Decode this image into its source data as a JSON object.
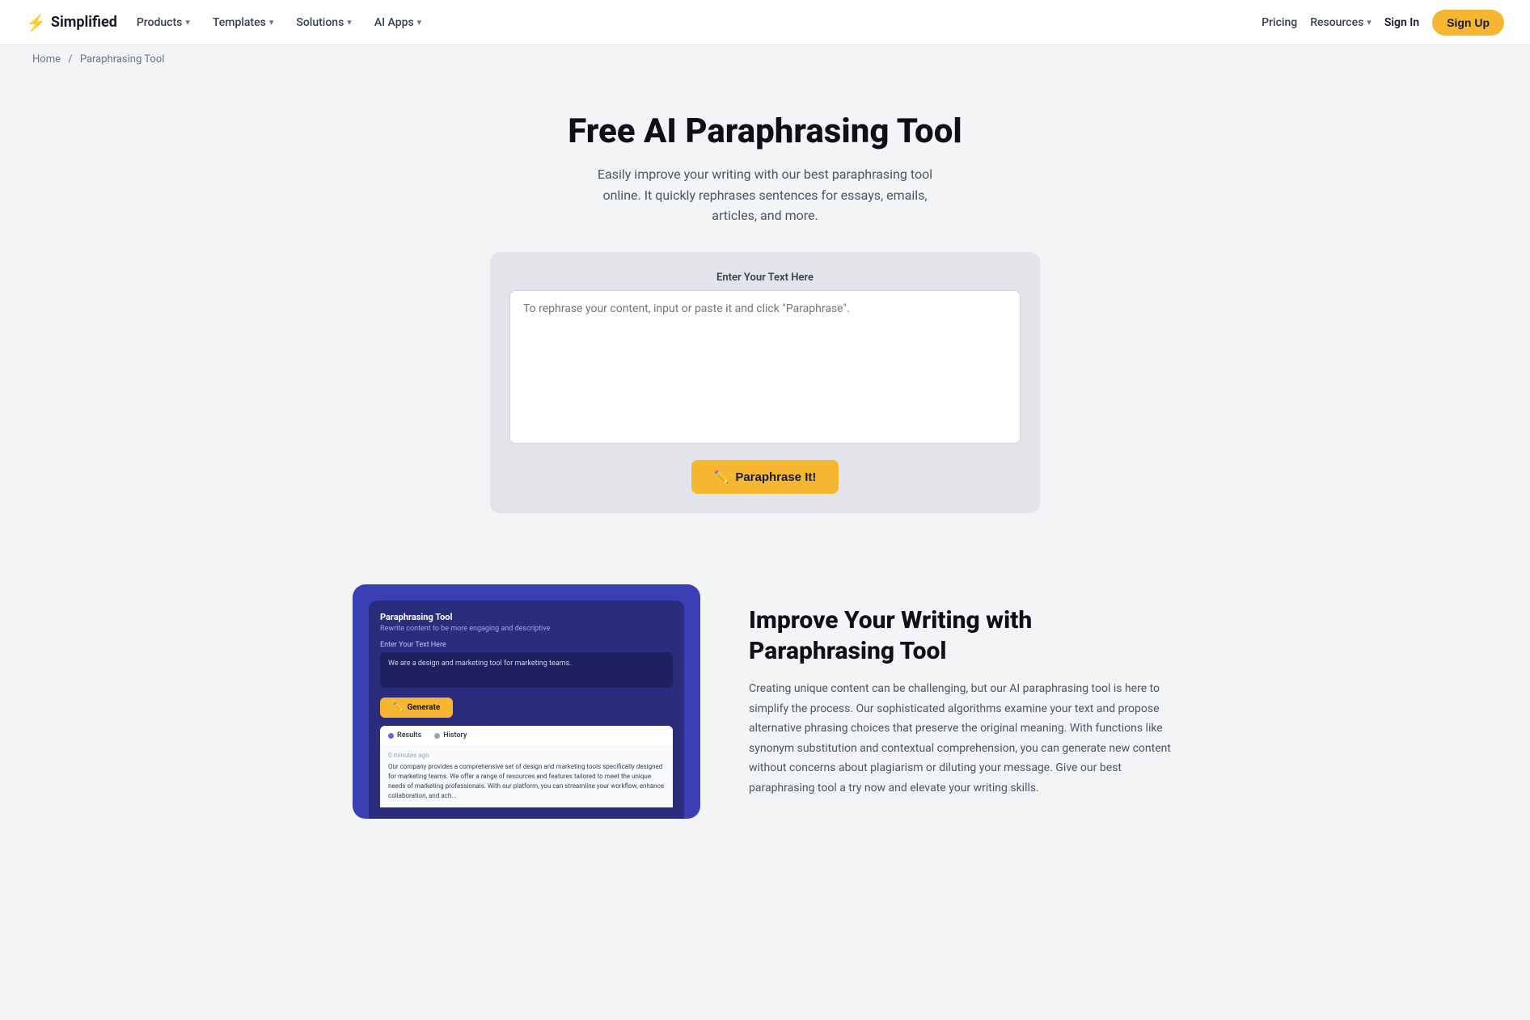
{
  "brand": {
    "logo_icon": "⚡",
    "logo_text": "Simplified"
  },
  "nav": {
    "items": [
      {
        "label": "Products",
        "has_dropdown": true
      },
      {
        "label": "Templates",
        "has_dropdown": true
      },
      {
        "label": "Solutions",
        "has_dropdown": true
      },
      {
        "label": "AI Apps",
        "has_dropdown": true
      }
    ],
    "right_items": [
      {
        "label": "Pricing",
        "has_dropdown": false
      },
      {
        "label": "Resources",
        "has_dropdown": true
      }
    ],
    "signin_label": "Sign In",
    "signup_label": "Sign Up"
  },
  "breadcrumb": {
    "home": "Home",
    "separator": "/",
    "current": "Paraphrasing Tool"
  },
  "hero": {
    "title": "Free AI Paraphrasing Tool",
    "description": "Easily improve your writing with our best paraphrasing tool online. It quickly rephrases sentences for essays, emails, articles, and more."
  },
  "tool": {
    "label": "Enter Your Text Here",
    "placeholder": "To rephrase your content, input or paste it and click \"Paraphrase\".",
    "button_icon": "✏️",
    "button_label": "Paraphrase It!"
  },
  "screenshot": {
    "title": "Paraphrasing Tool",
    "subtitle": "Rewrite content to be more engaging and descriptive",
    "input_label": "Enter Your Text Here",
    "input_text": "We are a design and marketing tool for marketing teams.",
    "generate_icon": "✏️",
    "generate_label": "Generate",
    "results_tab": "Results",
    "history_tab": "History",
    "output_meta": "0 minutes ago",
    "output_text": "Our company provides a comprehensive set of design and marketing tools specifically designed for marketing teams. We offer a range of resources and features tailored to meet the unique needs of marketing professionals. With our platform, you can streamline your workflow, enhance collaboration, and ach..."
  },
  "feature": {
    "title": "Improve Your Writing with Paraphrasing Tool",
    "description": "Creating unique content can be challenging, but our AI paraphrasing tool is here to simplify the process. Our sophisticated algorithms examine your text and propose alternative phrasing choices that preserve the original meaning. With functions like synonym substitution and contextual comprehension, you can generate new content without concerns about plagiarism or diluting your message. Give our best paraphrasing tool a try now and elevate your writing skills."
  }
}
